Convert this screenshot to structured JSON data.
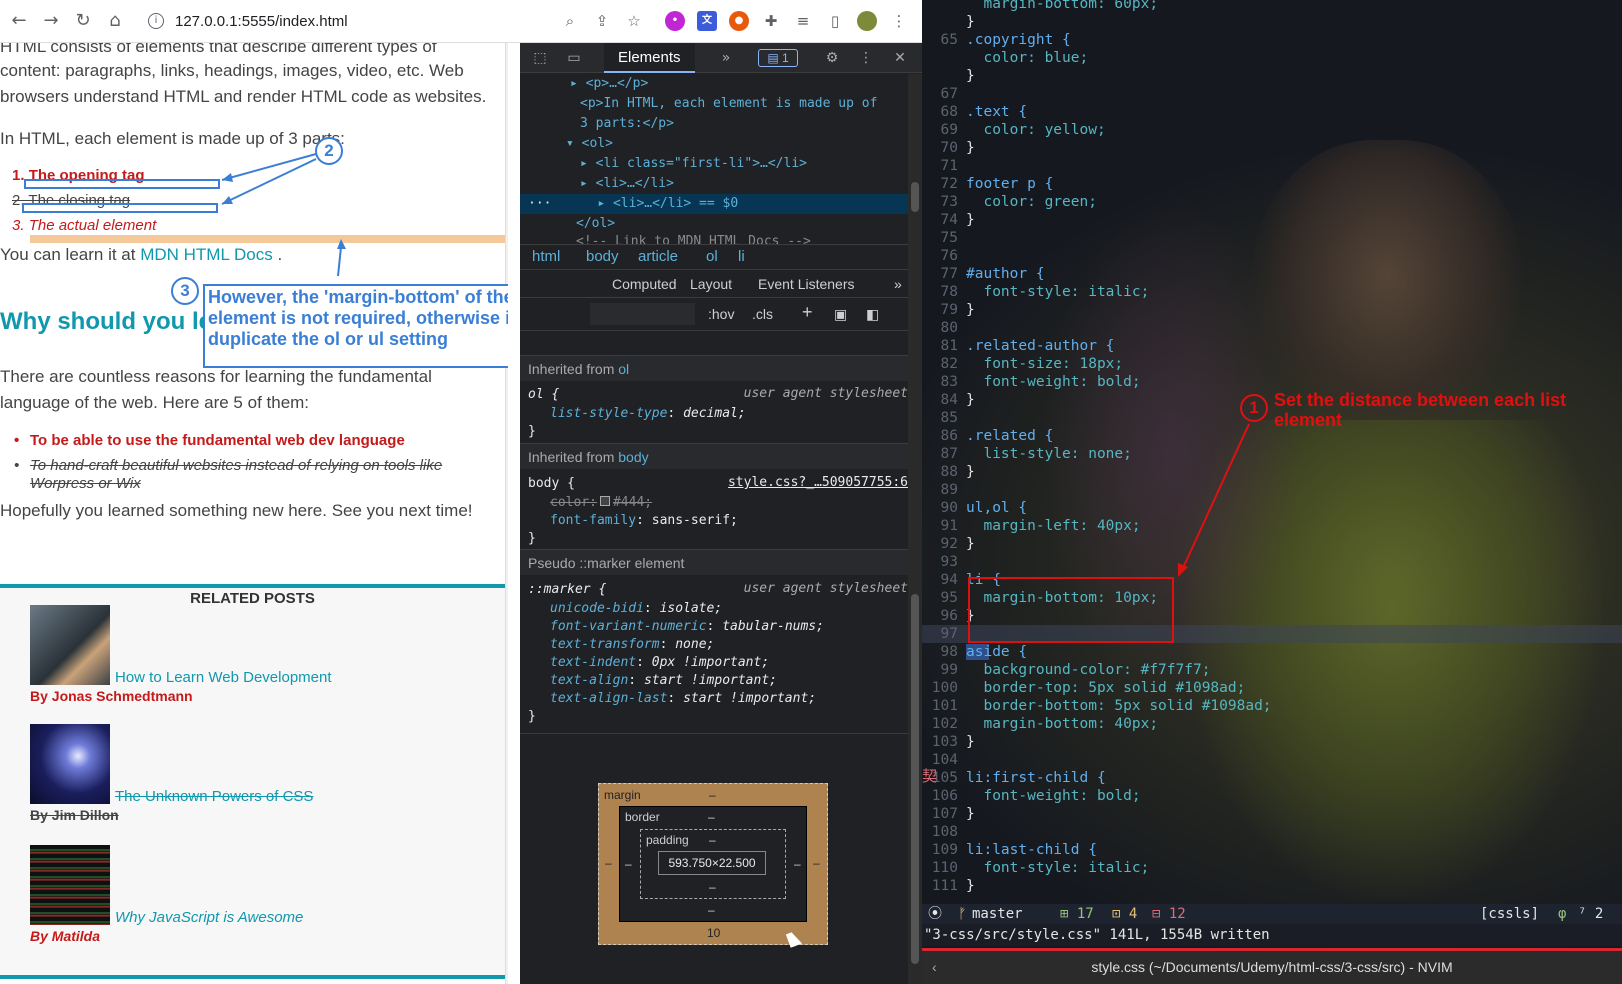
{
  "browser": {
    "url": "127.0.0.1:5555/index.html",
    "toolbar_icons": [
      "back-arrow-icon",
      "forward-arrow-icon",
      "reload-icon",
      "home-icon",
      "zoom-icon",
      "share-icon",
      "star-icon",
      "extensions-icon",
      "reading-list-icon",
      "sidebar-icon",
      "profile-avatar",
      "menu-icon"
    ]
  },
  "page": {
    "intro_partial": "HTML consists of elements that describe different types of",
    "intro_line2": "content: paragraphs, links, headings, images, video, etc. Web",
    "intro_line3": "browsers understand HTML and render HTML code as websites.",
    "parts_intro": "In HTML, each element is made up of 3 parts:",
    "ol_items": [
      {
        "num": "1.",
        "text": "The opening tag"
      },
      {
        "num": "2.",
        "text": "The closing tag"
      },
      {
        "num": "3.",
        "text": "The actual element"
      }
    ],
    "learn_prefix": "You can learn it at ",
    "learn_link": "MDN HTML Docs",
    "learn_suffix": " .",
    "h2": "Why should you le",
    "reasons_line1": "There are countless reasons for learning the fundamental",
    "reasons_line2": "language of the web. Here are 5 of them:",
    "ul_items": [
      {
        "line1": "To be able to use the fundamental web dev language",
        "line2": ""
      },
      {
        "line1": "To hand-craft beautiful websites instead of relying on tools like",
        "line2": "Worpress or Wix"
      }
    ],
    "closing": "Hopefully you learned something new here. See you next time!",
    "aside": {
      "title": "RELATED POSTS",
      "posts": [
        {
          "title": "How to Learn Web Development",
          "author": "By Jonas Schmedtmann",
          "image": "laptop-man-thumbnail"
        },
        {
          "title": "The Unknown Powers of CSS",
          "author": "By Jim Dillon",
          "image": "lightning-thumbnail"
        },
        {
          "title": "Why JavaScript is Awesome",
          "author": "By Matilda",
          "image": "code-screen-thumbnail"
        }
      ]
    }
  },
  "annotations": {
    "two": "2",
    "three": "3",
    "note": "However, the 'margin-bottom' of the last list element is not required, otherwise it would duplicate the ol or ul setting",
    "one": "1",
    "one_text": "Set the distance between each list element"
  },
  "devtools": {
    "elements_tab": "Elements",
    "issues_badge": "1",
    "dom": [
      "<p>…</p>",
      "<p>In HTML, each element is made up of",
      "3 parts:</p>",
      "<ol>",
      "<li class=\"first-li\">…</li>",
      "<li>…</li>",
      "<li>…</li> == $0",
      "</ol>",
      "<!-- Link to MDN HTML Docs -->"
    ],
    "breadcrumbs": [
      "html",
      "body",
      "article",
      "ol",
      "li"
    ],
    "styles_tabs": [
      "Computed",
      "Layout",
      "Event Listeners"
    ],
    "filter_tools": [
      ":hov",
      ".cls",
      "+"
    ],
    "inherited_ol": "Inherited from ",
    "ol_tag": "ol",
    "ol_rule": {
      "selector": "ol {",
      "source": "user agent stylesheet",
      "prop": "list-style-type",
      "value": "decimal;"
    },
    "inherited_body": "Inherited from ",
    "body_tag": "body",
    "body_rule": {
      "selector": "body {",
      "source": "style.css?_…509057755:6",
      "prop1": "color:",
      "value1": "#444;",
      "prop2": "font-family",
      "value2": "sans-serif;"
    },
    "pseudo_head": "Pseudo ::marker element",
    "marker_rule": {
      "selector": "::marker {",
      "source": "user agent stylesheet",
      "props": [
        {
          "p": "unicode-bidi",
          "v": "isolate;"
        },
        {
          "p": "font-variant-numeric",
          "v": "tabular-nums;"
        },
        {
          "p": "text-transform",
          "v": "none;"
        },
        {
          "p": "text-indent",
          "v": "0px !important;"
        },
        {
          "p": "text-align",
          "v": "start !important;"
        },
        {
          "p": "text-align-last",
          "v": "start !important;"
        }
      ]
    },
    "box_model": {
      "margin": "margin",
      "border": "border",
      "padding": "padding",
      "content": "593.750×22.500",
      "dash": "–",
      "margin_bottom": "10"
    }
  },
  "editor": {
    "lines": [
      {
        "n": "",
        "code": "  margin-bottom: 60px;"
      },
      {
        "n": "",
        "code": "}"
      },
      {
        "n": "65",
        "code": ".copyright {"
      },
      {
        "n": "",
        "code": "  color: blue;"
      },
      {
        "n": "",
        "code": "}"
      },
      {
        "n": "67",
        "code": ""
      },
      {
        "n": "68",
        "code": ".text {"
      },
      {
        "n": "69",
        "code": "  color: yellow;"
      },
      {
        "n": "70",
        "code": "}"
      },
      {
        "n": "71",
        "code": ""
      },
      {
        "n": "72",
        "code": "footer p {"
      },
      {
        "n": "73",
        "code": "  color: green;"
      },
      {
        "n": "74",
        "code": "}"
      },
      {
        "n": "75",
        "code": ""
      },
      {
        "n": "76",
        "code": ""
      },
      {
        "n": "77",
        "code": "#author {"
      },
      {
        "n": "78",
        "code": "  font-style: italic;"
      },
      {
        "n": "79",
        "code": "}"
      },
      {
        "n": "80",
        "code": ""
      },
      {
        "n": "81",
        "code": ".related-author {"
      },
      {
        "n": "82",
        "code": "  font-size: 18px;"
      },
      {
        "n": "83",
        "code": "  font-weight: bold;"
      },
      {
        "n": "84",
        "code": "}"
      },
      {
        "n": "85",
        "code": ""
      },
      {
        "n": "86",
        "code": ".related {"
      },
      {
        "n": "87",
        "code": "  list-style: none;"
      },
      {
        "n": "88",
        "code": "}"
      },
      {
        "n": "89",
        "code": ""
      },
      {
        "n": "90",
        "code": "ul,ol {"
      },
      {
        "n": "91",
        "code": "  margin-left: 40px;"
      },
      {
        "n": "92",
        "code": "}"
      },
      {
        "n": "93",
        "code": ""
      },
      {
        "n": "94",
        "code": "li {"
      },
      {
        "n": "95",
        "code": "  margin-bottom: 10px;"
      },
      {
        "n": "96",
        "code": "}"
      },
      {
        "n": "97",
        "code": ""
      },
      {
        "n": "98",
        "code": "aside {"
      },
      {
        "n": "99",
        "code": "  background-color: #f7f7f7;"
      },
      {
        "n": "100",
        "code": "  border-top: 5px solid #1098ad;"
      },
      {
        "n": "101",
        "code": "  border-bottom: 5px solid #1098ad;"
      },
      {
        "n": "102",
        "code": "  margin-bottom: 40px;"
      },
      {
        "n": "103",
        "code": "}"
      },
      {
        "n": "104",
        "code": ""
      },
      {
        "n": "105",
        "code": "li:first-child {"
      },
      {
        "n": "106",
        "code": "  font-weight: bold;"
      },
      {
        "n": "107",
        "code": "}"
      },
      {
        "n": "108",
        "code": ""
      },
      {
        "n": "109",
        "code": "li:last-child {"
      },
      {
        "n": "110",
        "code": "  font-style: italic;"
      },
      {
        "n": "111",
        "code": "}"
      }
    ],
    "status": {
      "mode": "⦿",
      "branch": "master",
      "added": "17",
      "changed": "4",
      "removed": "12",
      "filetype": "[cssls]",
      "right": "⁷ 2"
    },
    "cmdline": "\"3-css/src/style.css\" 141L, 1554B written",
    "window_title": "style.css (~/Documents/Udemy/html-css/3-css/src) - NVIM",
    "side_glyph": "契"
  },
  "colors": {
    "brand": "#1098ad",
    "accent_red": "#c41a1a",
    "annotation_blue": "#3a7fd5",
    "annotation_red": "#e01010"
  }
}
